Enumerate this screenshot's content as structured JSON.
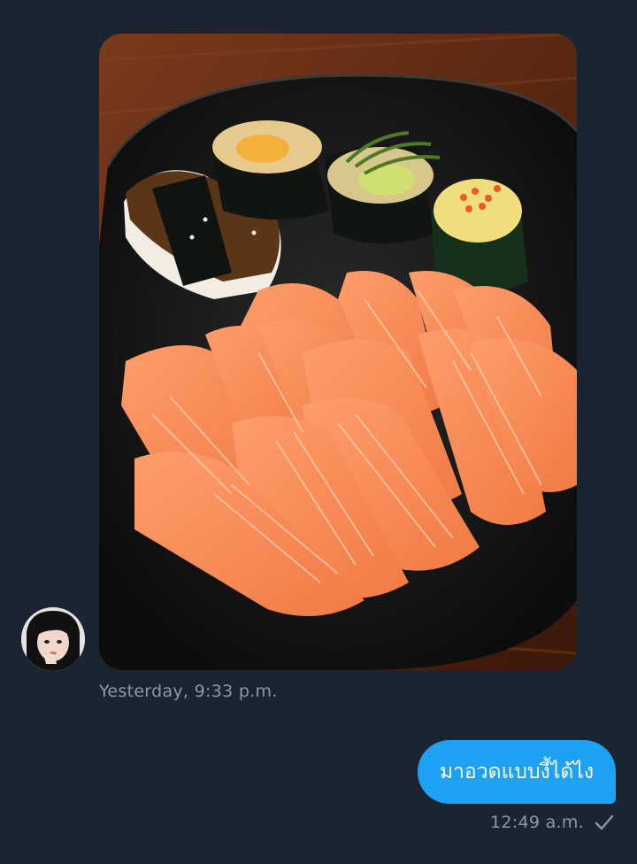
{
  "conversation": {
    "received": {
      "photo_alt": "Salmon sashimi and sushi rolls on a black plate",
      "timestamp": "Yesterday, 9:33 p.m."
    },
    "sent": {
      "text": "มาอวดแบบงี้ได้ไง",
      "timestamp": "12:49 a.m.",
      "status_icon": "checkmark-icon"
    }
  },
  "colors": {
    "background": "#1b2532",
    "sent_bubble": "#1da1f2",
    "meta_text": "#8a98a8"
  }
}
